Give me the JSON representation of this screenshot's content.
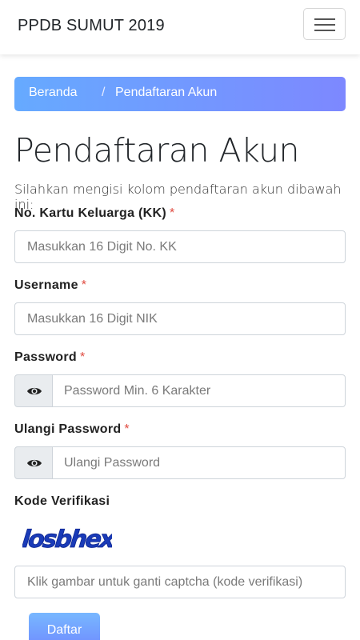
{
  "navbar": {
    "brand": "PPDB SUMUT 2019",
    "toggle_icon": "hamburger-menu-icon"
  },
  "breadcrumb": {
    "home": "Beranda",
    "separator": "/",
    "current": "Pendaftaran Akun",
    "gradient_start": "#66aaff",
    "gradient_end": "#7d88ff"
  },
  "page": {
    "title": "Pendaftaran Akun",
    "lead": "Silahkan mengisi kolom pendaftaran akun dibawah ini:"
  },
  "form": {
    "required_mark": "*",
    "required_color": "#e04a3f",
    "kk": {
      "label": "No. Kartu Keluarga (KK)",
      "placeholder": "Masukkan 16 Digit No. KK",
      "value": ""
    },
    "username": {
      "label": "Username",
      "placeholder": "Masukkan 16 Digit NIK",
      "value": ""
    },
    "password": {
      "label": "Password",
      "placeholder": "Password Min. 6 Karakter",
      "icon": "eye-icon",
      "value": ""
    },
    "repeat_password": {
      "label": "Ulangi Password",
      "placeholder": "Ulangi Password",
      "icon": "eye-icon",
      "value": ""
    },
    "captcha": {
      "label": "Kode Verifikasi",
      "image_text": "losbhex",
      "placeholder": "Klik gambar untuk ganti captcha (kode verifikasi)",
      "value": ""
    },
    "submit_label": "Daftar"
  }
}
